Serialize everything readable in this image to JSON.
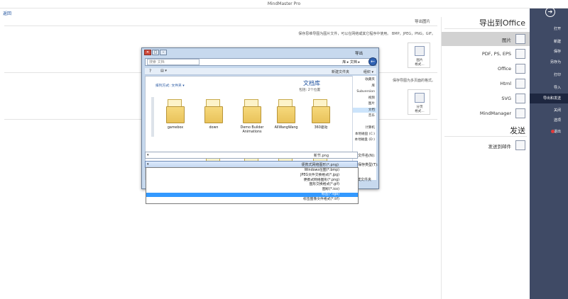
{
  "window": {
    "title": "MindMaster Pro"
  },
  "back": {
    "label": "返回"
  },
  "main": {
    "heading": "导出图片",
    "desc1": "保存思维导图为图片文件，可以在网络或其它程序中使用。 BMP，JPEG，PNG，GIF。",
    "tile1": "图片\n格式...",
    "desc2": "保存导图为多页面的格式。",
    "tile2": "分页\n格式..."
  },
  "export": {
    "section_title": "导出到Office",
    "items": [
      {
        "label": "图片",
        "icon": "image-icon",
        "selected": true
      },
      {
        "label": "PDF, PS, EPS",
        "icon": "pdf-icon",
        "selected": false
      },
      {
        "label": "Office",
        "icon": "office-icon",
        "selected": false
      },
      {
        "label": "Html",
        "icon": "html-icon",
        "selected": false
      },
      {
        "label": "SVG",
        "icon": "svg-icon",
        "selected": false
      },
      {
        "label": "MindManager",
        "icon": "mindmanager-icon",
        "selected": false
      }
    ],
    "send_title": "发送",
    "send_items": [
      {
        "label": "发送到邮件",
        "icon": "email-icon"
      }
    ]
  },
  "sidebar": {
    "items": [
      {
        "label": "打开",
        "selected": false
      },
      {
        "label": "新建",
        "selected": false
      },
      {
        "label": "保存",
        "selected": false
      },
      {
        "label": "另存为",
        "selected": false
      },
      {
        "label": "打印",
        "selected": false
      },
      {
        "label": "导入",
        "selected": false
      },
      {
        "label": "导出和发送",
        "selected": true
      },
      {
        "label": "关闭",
        "selected": false
      },
      {
        "label": "选项",
        "selected": false
      },
      {
        "label": "退出",
        "selected": false
      }
    ]
  },
  "dialog": {
    "title": "导出",
    "path": "库 ▸ 文档 ▸",
    "search_placeholder": "搜索 文档",
    "organize": "组织 ▾",
    "newfolder": "新建文件夹",
    "library_title": "文档库",
    "library_sub": "包括: 2个位置",
    "arrange_label": "排列方式: 文件夹 ▾",
    "folders": [
      "360驱动",
      "AllWangWang",
      "Demo Builder Animations",
      "down",
      "gamebox"
    ],
    "nav": [
      "收藏夹",
      "库",
      "Subversion",
      "视频",
      "图片",
      "文档",
      "音乐",
      "",
      "计算机",
      "本地磁盘 (C:)",
      "本地磁盘 (D:)"
    ],
    "filename_label": "文件名(N):",
    "filename_value": "新节.png",
    "filetype_label": "保存类型(T):",
    "filetype_value": "便携式网络图形(*.png)",
    "hide_folders": "隐藏文件夹",
    "dropdown": [
      "Windows位图(*.bmp)",
      "JPEG文件交换格式(*.jpg)",
      "便携式网络图形(*.png)",
      "图形交换格式(*.gif)",
      "图标(*.ico)",
      "标签(*.tga)",
      "标签图像文件格式(*.tif)"
    ],
    "dropdown_highlight": 5
  }
}
